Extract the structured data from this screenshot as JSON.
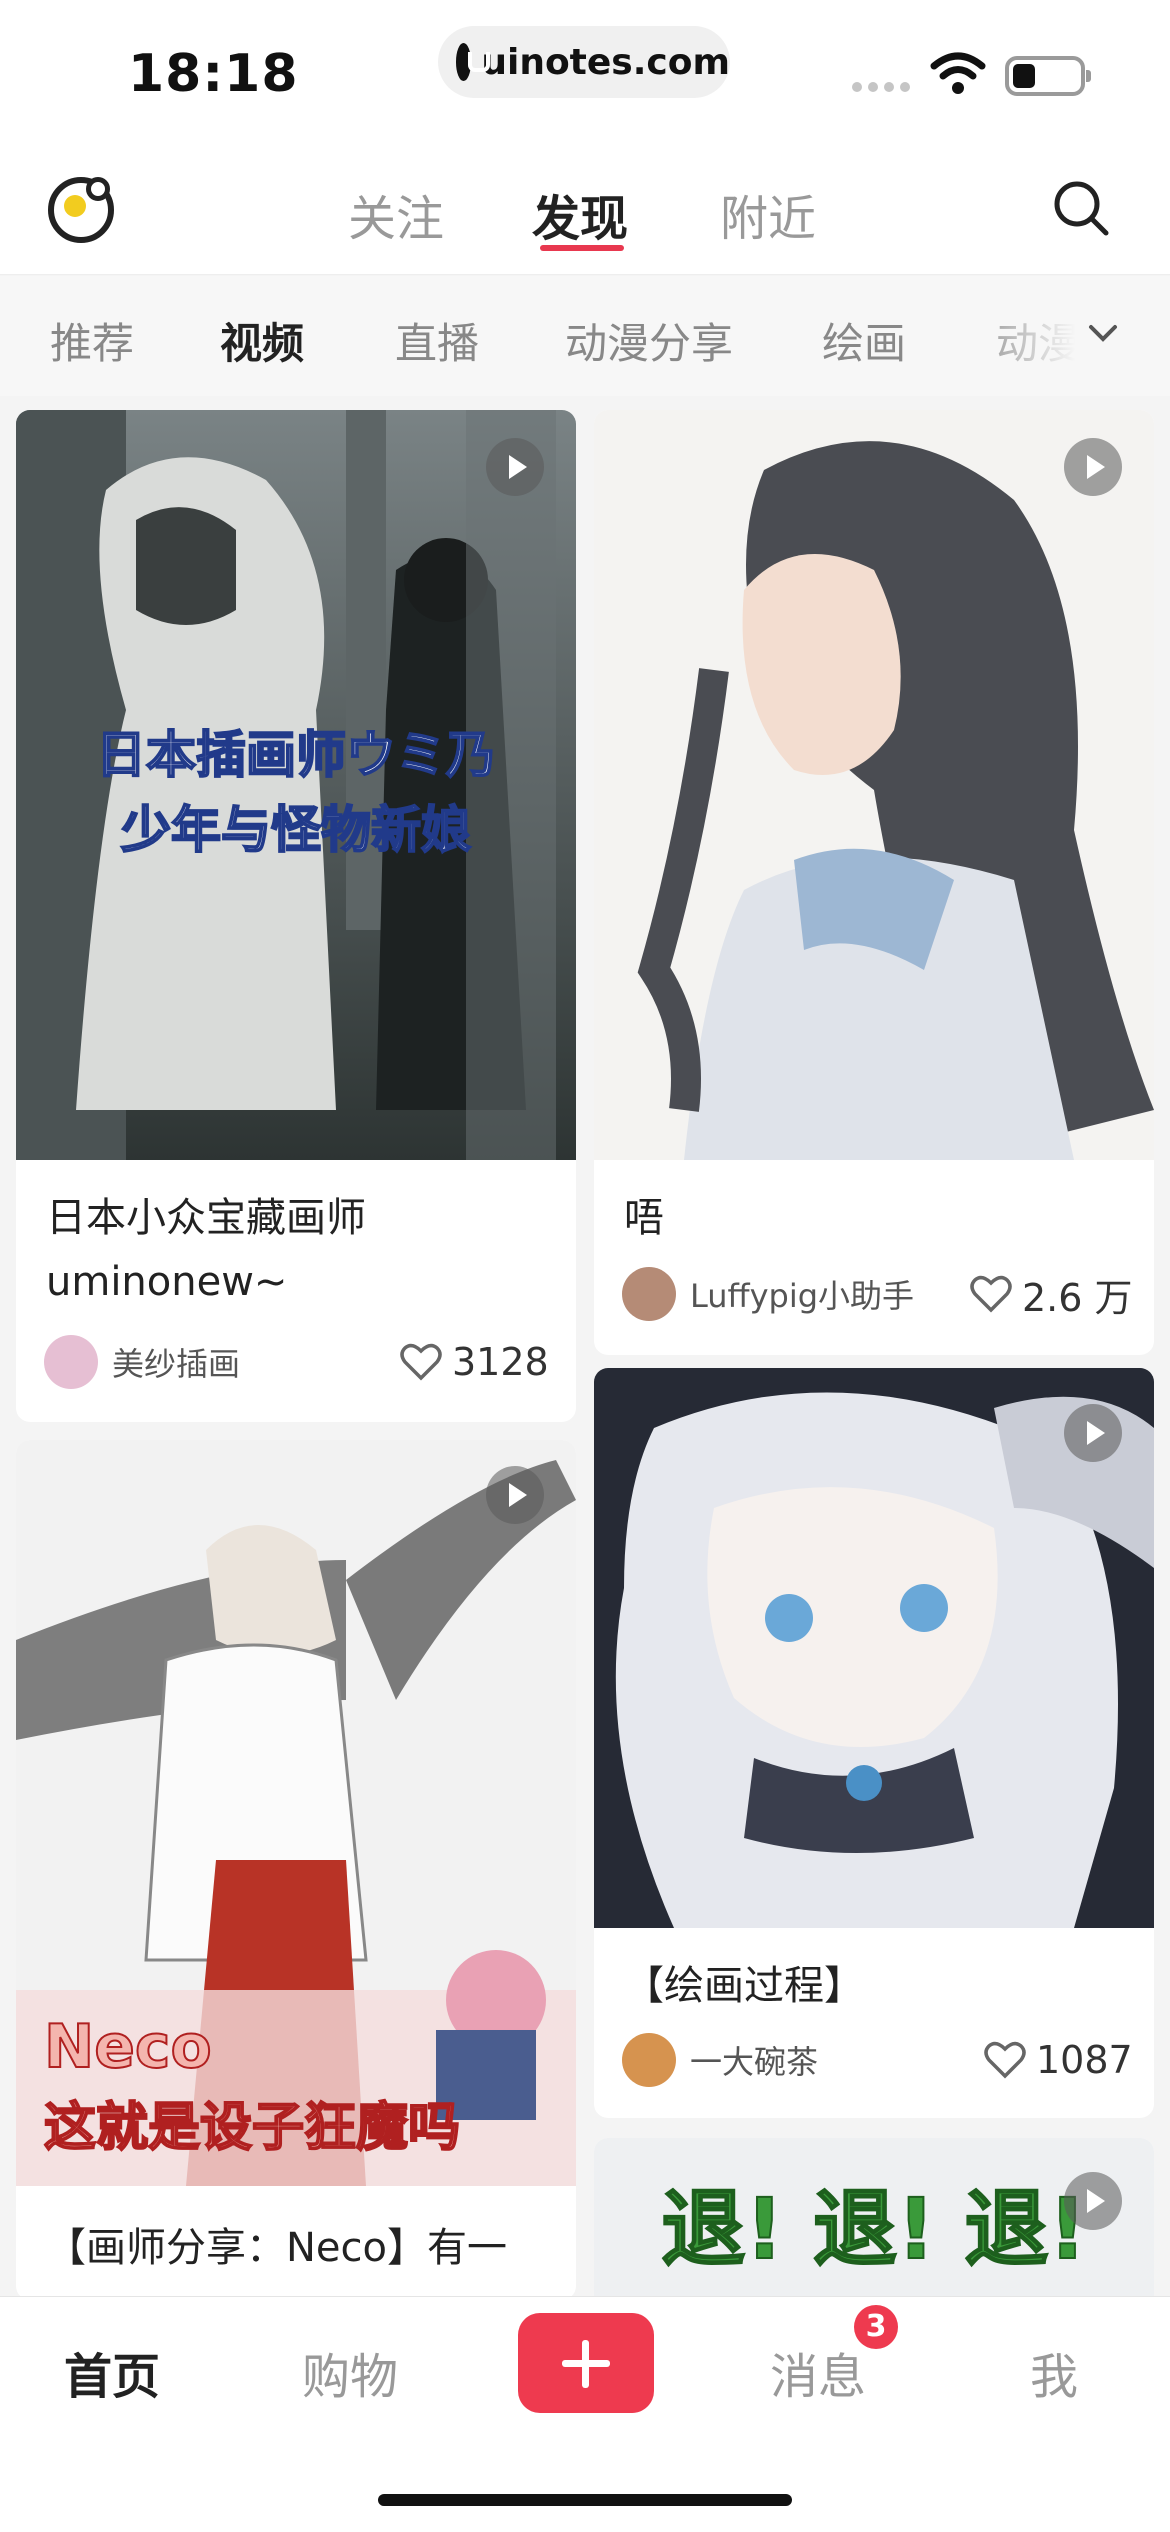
{
  "status_bar": {
    "time": "18:18",
    "url": "uinotes.com"
  },
  "top_nav": {
    "tabs": [
      {
        "label": "关注",
        "active": false
      },
      {
        "label": "发现",
        "active": true
      },
      {
        "label": "附近",
        "active": false
      }
    ],
    "accent_color": "#e8384f"
  },
  "categories": {
    "items": [
      {
        "label": "推荐",
        "active": false
      },
      {
        "label": "视频",
        "active": true
      },
      {
        "label": "直播",
        "active": false
      },
      {
        "label": "动漫分享",
        "active": false
      },
      {
        "label": "绘画",
        "active": false
      },
      {
        "label": "动漫",
        "active": false
      }
    ]
  },
  "feed": {
    "cards": [
      {
        "overlay_line1": "日本插画师ウミ乃",
        "overlay_line2": "少年与怪物新娘",
        "title_line1": "日本小众宝藏画师",
        "title_line2": "uminonew~",
        "author": "美纱插画",
        "likes": "3128",
        "is_video": true
      },
      {
        "title_line1": "唔",
        "author": "Luffypig小助手",
        "likes": "2.6 万",
        "is_video": true
      },
      {
        "overlay_line1": "Neco",
        "overlay_line2": "这就是设子狂魔吗",
        "title_line1": "【画师分享：Neco】有一",
        "is_video": true
      },
      {
        "title_line1": "【绘画过程】",
        "author": "一大碗茶",
        "likes": "1087",
        "is_video": true
      },
      {
        "overlay_line1": "退! 退! 退!",
        "is_video": true
      }
    ]
  },
  "bottom_bar": {
    "tabs": [
      {
        "label": "首页",
        "active": true
      },
      {
        "label": "购物",
        "active": false
      },
      {
        "label": "消息",
        "active": false,
        "badge": "3"
      },
      {
        "label": "我",
        "active": false
      }
    ],
    "add_color": "#ee3a4f"
  }
}
